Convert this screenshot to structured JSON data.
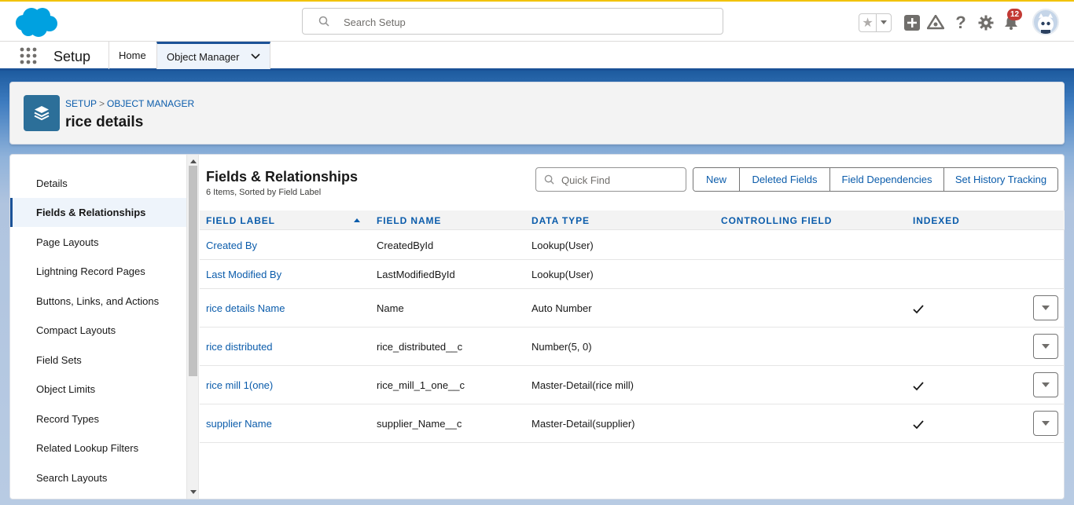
{
  "header": {
    "search_placeholder": "Search Setup",
    "notification_count": "12"
  },
  "nav": {
    "app_name": "Setup",
    "tabs": [
      {
        "label": "Home"
      },
      {
        "label": "Object Manager"
      }
    ]
  },
  "page_header": {
    "breadcrumb": [
      "SETUP",
      "OBJECT MANAGER"
    ],
    "title": "rice details"
  },
  "sidebar": {
    "items": [
      {
        "label": "Details"
      },
      {
        "label": "Fields & Relationships"
      },
      {
        "label": "Page Layouts"
      },
      {
        "label": "Lightning Record Pages"
      },
      {
        "label": "Buttons, Links, and Actions"
      },
      {
        "label": "Compact Layouts"
      },
      {
        "label": "Field Sets"
      },
      {
        "label": "Object Limits"
      },
      {
        "label": "Record Types"
      },
      {
        "label": "Related Lookup Filters"
      },
      {
        "label": "Search Layouts"
      }
    ],
    "active_item": "Fields & Relationships"
  },
  "main": {
    "title": "Fields & Relationships",
    "subtitle": "6 Items, Sorted by Field Label",
    "quick_find_placeholder": "Quick Find",
    "buttons": [
      "New",
      "Deleted Fields",
      "Field Dependencies",
      "Set History Tracking"
    ],
    "columns": [
      "FIELD LABEL",
      "FIELD NAME",
      "DATA TYPE",
      "CONTROLLING FIELD",
      "INDEXED"
    ],
    "rows": [
      {
        "label": "Created By",
        "name": "CreatedById",
        "type": "Lookup(User)",
        "controlling": "",
        "indexed": false,
        "menu": false
      },
      {
        "label": "Last Modified By",
        "name": "LastModifiedById",
        "type": "Lookup(User)",
        "controlling": "",
        "indexed": false,
        "menu": false
      },
      {
        "label": "rice details Name",
        "name": "Name",
        "type": "Auto Number",
        "controlling": "",
        "indexed": true,
        "menu": true
      },
      {
        "label": "rice distributed",
        "name": "rice_distributed__c",
        "type": "Number(5, 0)",
        "controlling": "",
        "indexed": false,
        "menu": true
      },
      {
        "label": "rice mill 1(one)",
        "name": "rice_mill_1_one__c",
        "type": "Master-Detail(rice mill)",
        "controlling": "",
        "indexed": true,
        "menu": true
      },
      {
        "label": "supplier Name",
        "name": "supplier_Name__c",
        "type": "Master-Detail(supplier)",
        "controlling": "",
        "indexed": true,
        "menu": true
      }
    ]
  },
  "colors": {
    "brand_blue": "#0b5cab",
    "nav_accent": "#1b5297",
    "top_border": "#f2c200",
    "badge_red": "#c23934",
    "cloud_blue": "#00a1e0",
    "object_icon_bg": "#2c6f99"
  },
  "icons": {
    "logo": "salesforce-cloud-logo",
    "search": "search-icon",
    "favorite": "star-icon",
    "add": "plus-icon",
    "trailhead": "trailhead-icon",
    "help": "help-icon",
    "settings": "gear-icon",
    "notifications": "bell-icon",
    "app_launcher": "waffle-icon",
    "object": "stack-icon",
    "row_menu": "chevron-down-icon",
    "indexed": "checkmark-icon"
  }
}
